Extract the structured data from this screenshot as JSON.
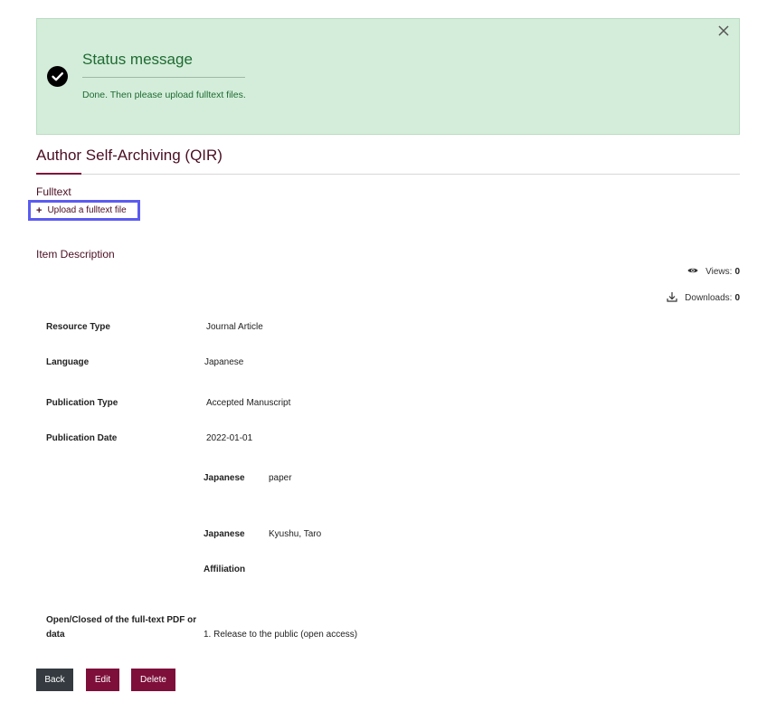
{
  "status": {
    "title": "Status message",
    "message": "Done. Then please upload fulltext files."
  },
  "page": {
    "title": "Author Self-Archiving (QIR)"
  },
  "fulltext": {
    "label": "Fulltext",
    "upload_link": "Upload a fulltext file"
  },
  "item_description": {
    "heading": "Item Description"
  },
  "stats": {
    "views_label": "Views:",
    "views_value": "0",
    "downloads_label": "Downloads:",
    "downloads_value": "0"
  },
  "fields": {
    "resource_type": {
      "label": "Resource Type",
      "value": "Journal Article"
    },
    "language": {
      "label": "Language",
      "value": "Japanese"
    },
    "publication_type": {
      "label": "Publication Type",
      "value": "Accepted Manuscript"
    },
    "publication_date": {
      "label": "Publication Date",
      "value": "2022-01-01"
    },
    "title": {
      "lang": "Japanese",
      "value": "paper"
    },
    "creator": {
      "lang": "Japanese",
      "value": "Kyushu, Taro",
      "affiliation_label": "Affiliation"
    },
    "open_closed": {
      "label_line1": "Open/Closed of the full-text PDF or",
      "label_line2": "data",
      "value": "1. Release to the public (open access)"
    }
  },
  "buttons": {
    "back": "Back",
    "edit": "Edit",
    "delete": "Delete"
  },
  "colors": {
    "accent": "#7d0f3a",
    "status_bg": "#d4edda",
    "status_text": "#1e6b32",
    "highlight": "#5b5bf0"
  }
}
